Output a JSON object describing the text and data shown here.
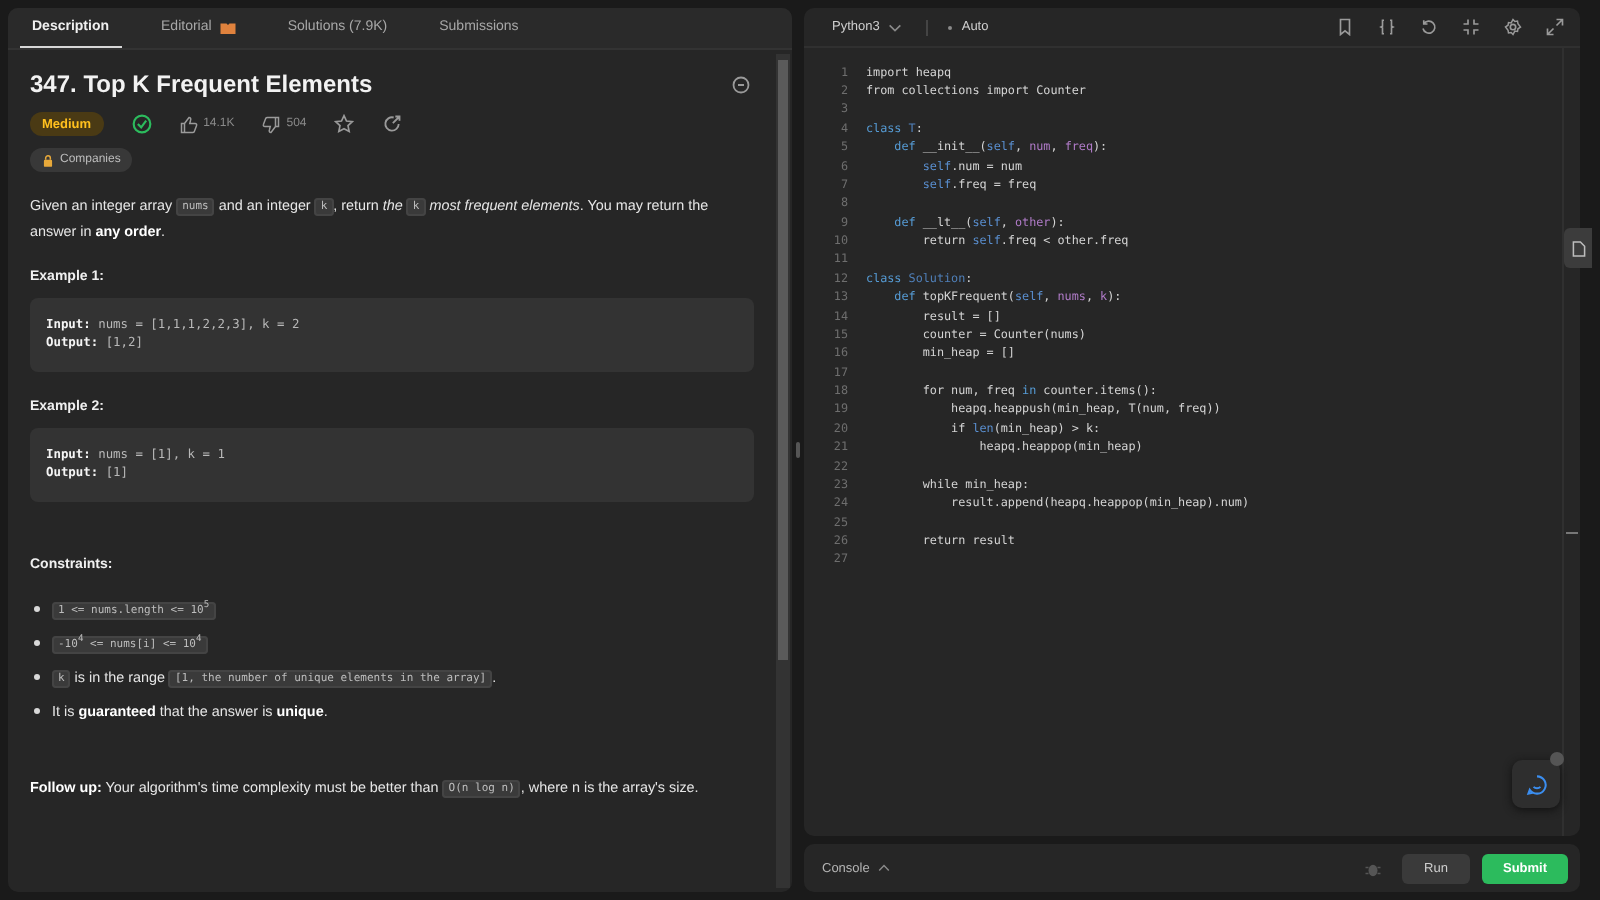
{
  "tabs": [
    {
      "label": "Description",
      "selected": true,
      "kind": "plain"
    },
    {
      "label": "Editorial",
      "selected": false,
      "kind": "editorial"
    },
    {
      "label": "Solutions (7.9K)",
      "selected": false,
      "kind": "plain"
    },
    {
      "label": "Submissions",
      "selected": false,
      "kind": "plain"
    }
  ],
  "problem": {
    "title": "347. Top K Frequent Elements",
    "difficulty": "Medium",
    "solved": true,
    "likes": "14.1K",
    "dislikes": "504",
    "companies": "Companies",
    "description": [
      {
        "kind": "text",
        "text": "Given an integer array "
      },
      {
        "kind": "code",
        "text": "nums"
      },
      {
        "kind": "text",
        "text": " and an integer "
      },
      {
        "kind": "code",
        "text": "k"
      },
      {
        "kind": "text",
        "text": ", return "
      },
      {
        "kind": "italic",
        "text": "the "
      },
      {
        "kind": "code",
        "text": "k"
      },
      {
        "kind": "italic",
        "text": " most frequent elements"
      },
      {
        "kind": "text",
        "text": ". You may return the answer in "
      },
      {
        "kind": "bold",
        "text": "any order"
      },
      {
        "kind": "text",
        "text": "."
      }
    ],
    "examples": [
      {
        "title": "Example 1:",
        "lines": [
          {
            "label": "Input:",
            "value": "nums = [1,1,1,2,2,3], k = 2"
          },
          {
            "label": "Output:",
            "value": "[1,2]"
          }
        ]
      },
      {
        "title": "Example 2:",
        "lines": [
          {
            "label": "Input:",
            "value": "nums = [1], k = 1"
          },
          {
            "label": "Output:",
            "value": "[1]"
          }
        ]
      }
    ],
    "constraints_title": "Constraints:",
    "constraints": [
      [
        {
          "kind": "code",
          "text": "1 <= nums.length <= 10$^{5}$"
        }
      ],
      [
        {
          "kind": "code",
          "text": "-10$^{4}$ <= nums[i] <= 10$^{4}$"
        }
      ],
      [
        {
          "kind": "code",
          "text": "k"
        },
        {
          "kind": "text",
          "text": " is in the range "
        },
        {
          "kind": "code",
          "text": "[1, the number of unique elements in the array]"
        },
        {
          "kind": "text",
          "text": "."
        }
      ],
      [
        {
          "kind": "text",
          "text": "It is "
        },
        {
          "kind": "bold",
          "text": "guaranteed"
        },
        {
          "kind": "text",
          "text": " that the answer is "
        },
        {
          "kind": "bold",
          "text": "unique"
        },
        {
          "kind": "text",
          "text": "."
        }
      ]
    ],
    "follow_up": [
      {
        "kind": "bold",
        "text": "Follow up:"
      },
      {
        "kind": "text",
        "text": " Your algorithm's time complexity must be better than "
      },
      {
        "kind": "code",
        "text": "O(n log n)"
      },
      {
        "kind": "text",
        "text": ", where n is the array's size."
      }
    ]
  },
  "editor": {
    "language": "Python3",
    "mode": "Auto",
    "lines": [
      {
        "num": "1",
        "tokens": [
          {
            "kind": "plain",
            "text": "import heapq"
          }
        ]
      },
      {
        "num": "2",
        "tokens": [
          {
            "kind": "plain",
            "text": "from collections import Counter"
          }
        ]
      },
      {
        "num": "3"
      },
      {
        "num": "4",
        "tokens": [
          {
            "kind": "kw",
            "text": "class"
          },
          {
            "kind": "cls",
            "text": " T"
          },
          {
            "kind": "plain",
            "text": ":"
          }
        ]
      },
      {
        "num": "5",
        "tokens": [
          {
            "kind": "kw",
            "text": "    def"
          },
          {
            "kind": "plain",
            "text": " __init__("
          },
          {
            "kind": "self",
            "text": "self"
          },
          {
            "kind": "plain",
            "text": ", "
          },
          {
            "kind": "param",
            "text": "num"
          },
          {
            "kind": "plain",
            "text": ", "
          },
          {
            "kind": "param",
            "text": "freq"
          },
          {
            "kind": "plain",
            "text": "):"
          }
        ]
      },
      {
        "num": "6",
        "tokens": [
          {
            "kind": "self",
            "text": "        self"
          },
          {
            "kind": "plain",
            "text": ".num = num"
          }
        ]
      },
      {
        "num": "7",
        "tokens": [
          {
            "kind": "self",
            "text": "        self"
          },
          {
            "kind": "plain",
            "text": ".freq = freq"
          }
        ]
      },
      {
        "num": "8"
      },
      {
        "num": "9",
        "tokens": [
          {
            "kind": "kw",
            "text": "    def"
          },
          {
            "kind": "plain",
            "text": " __lt__("
          },
          {
            "kind": "self",
            "text": "self"
          },
          {
            "kind": "plain",
            "text": ", "
          },
          {
            "kind": "param",
            "text": "other"
          },
          {
            "kind": "plain",
            "text": "):"
          }
        ]
      },
      {
        "num": "10",
        "tokens": [
          {
            "kind": "plain",
            "text": "        return "
          },
          {
            "kind": "self",
            "text": "self"
          },
          {
            "kind": "plain",
            "text": ".freq < other.freq"
          }
        ]
      },
      {
        "num": "11"
      },
      {
        "num": "12",
        "tokens": [
          {
            "kind": "kw",
            "text": "class"
          },
          {
            "kind": "cls",
            "text": " Solution"
          },
          {
            "kind": "plain",
            "text": ":"
          }
        ]
      },
      {
        "num": "13",
        "tokens": [
          {
            "kind": "kw",
            "text": "    def"
          },
          {
            "kind": "plain",
            "text": " topKFrequent("
          },
          {
            "kind": "self",
            "text": "self"
          },
          {
            "kind": "plain",
            "text": ", "
          },
          {
            "kind": "param",
            "text": "nums"
          },
          {
            "kind": "plain",
            "text": ", "
          },
          {
            "kind": "param",
            "text": "k"
          },
          {
            "kind": "plain",
            "text": "):"
          }
        ]
      },
      {
        "num": "14",
        "tokens": [
          {
            "kind": "plain",
            "text": "        result = []"
          }
        ]
      },
      {
        "num": "15",
        "tokens": [
          {
            "kind": "plain",
            "text": "        counter = Counter(nums)"
          }
        ]
      },
      {
        "num": "16",
        "tokens": [
          {
            "kind": "plain",
            "text": "        min_heap = []"
          }
        ]
      },
      {
        "num": "17"
      },
      {
        "num": "18",
        "tokens": [
          {
            "kind": "plain",
            "text": "        for num, freq "
          },
          {
            "kind": "kw",
            "text": "in"
          },
          {
            "kind": "plain",
            "text": " counter.items():"
          }
        ]
      },
      {
        "num": "19",
        "tokens": [
          {
            "kind": "plain",
            "text": "            heapq.heappush(min_heap, T(num, freq))"
          }
        ]
      },
      {
        "num": "20",
        "tokens": [
          {
            "kind": "plain",
            "text": "            if "
          },
          {
            "kind": "self",
            "text": "len"
          },
          {
            "kind": "plain",
            "text": "(min_heap) > k:"
          }
        ]
      },
      {
        "num": "21",
        "tokens": [
          {
            "kind": "plain",
            "text": "                heapq.heappop(min_heap)"
          }
        ]
      },
      {
        "num": "22"
      },
      {
        "num": "23",
        "tokens": [
          {
            "kind": "plain",
            "text": "        while min_heap:"
          }
        ]
      },
      {
        "num": "24",
        "tokens": [
          {
            "kind": "plain",
            "text": "            result.append(heapq.heappop(min_heap).num)"
          }
        ]
      },
      {
        "num": "25"
      },
      {
        "num": "26",
        "tokens": [
          {
            "kind": "plain",
            "text": "        return result"
          }
        ]
      },
      {
        "num": "27"
      }
    ]
  },
  "console": {
    "label": "Console",
    "run": "Run",
    "submit": "Submit"
  }
}
